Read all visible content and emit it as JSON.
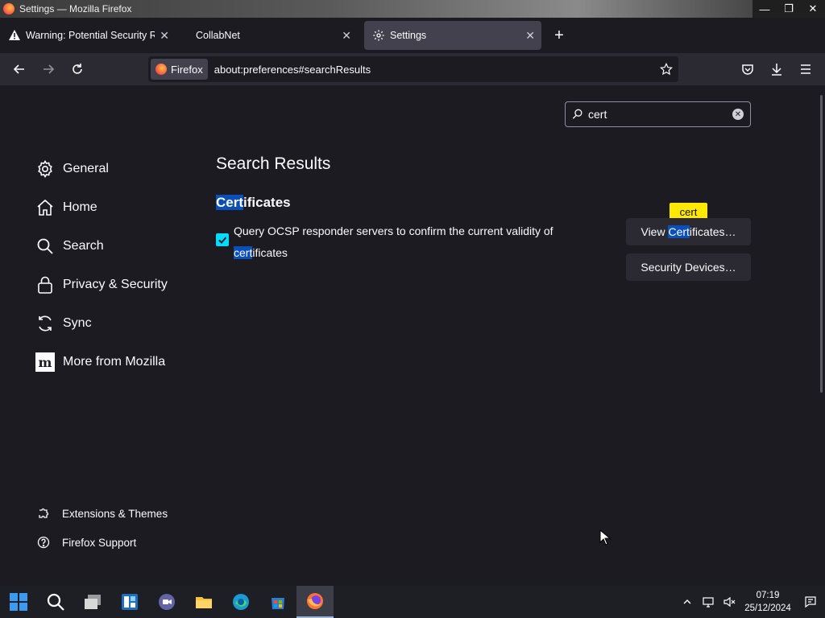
{
  "window": {
    "title": "Settings — Mozilla Firefox"
  },
  "tabs": [
    {
      "label": "Warning: Potential Security Risk Ahead",
      "icon": "warning-icon"
    },
    {
      "label": "CollabNet",
      "icon": ""
    },
    {
      "label": "Settings",
      "icon": "gear-icon",
      "active": true
    }
  ],
  "urlbar": {
    "identity_label": "Firefox",
    "url": "about:preferences#searchResults"
  },
  "search": {
    "value": "cert"
  },
  "sidebar": {
    "items": [
      {
        "label": "General",
        "icon": "gear-icon"
      },
      {
        "label": "Home",
        "icon": "home-icon"
      },
      {
        "label": "Search",
        "icon": "search-icon"
      },
      {
        "label": "Privacy & Security",
        "icon": "lock-icon"
      },
      {
        "label": "Sync",
        "icon": "sync-icon"
      },
      {
        "label": "More from Mozilla",
        "icon": "mozilla-icon"
      }
    ],
    "footer": [
      {
        "label": "Extensions & Themes",
        "icon": "puzzle-icon"
      },
      {
        "label": "Firefox Support",
        "icon": "help-icon"
      }
    ]
  },
  "main": {
    "results_title": "Search Results",
    "section": {
      "hl": "Cert",
      "rest": "ificates"
    },
    "ocsp": {
      "text_line1": "Query OCSP responder servers to confirm the current validity of",
      "hl": "cert",
      "rest": "ificates",
      "checked": true
    },
    "buttons": {
      "certs_pre": "View ",
      "certs_hl": "Cert",
      "certs_post": "ificates…",
      "devices": "Security Devices…"
    },
    "tooltip": "cert"
  },
  "taskbar": {
    "apps": [
      "start-icon",
      "search-icon",
      "task-view-icon",
      "widgets-icon",
      "chat-icon",
      "file-explorer-icon",
      "edge-icon",
      "store-icon",
      "firefox-icon"
    ],
    "time": "07:19",
    "date": "25/12/2024"
  },
  "colors": {
    "accent": "#00ddff",
    "highlight": "#0b4fb8",
    "tooltip": "#ffe900"
  }
}
